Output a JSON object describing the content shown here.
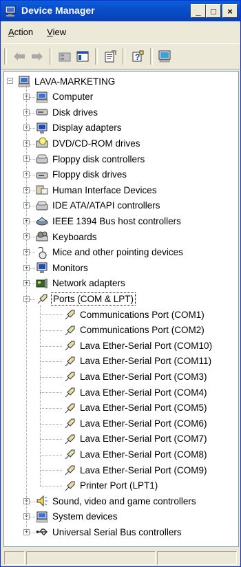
{
  "window": {
    "title": "Device Manager"
  },
  "menu": [
    {
      "label": "Action",
      "accel": "A",
      "rest": "ction"
    },
    {
      "label": "View",
      "accel": "V",
      "rest": "iew"
    }
  ],
  "caption_buttons": {
    "minimize": "_",
    "maximize": "□",
    "close": "×"
  },
  "tree": {
    "root": {
      "label": "LAVA-MARKETING",
      "icon": "computer-icon"
    },
    "categories": [
      {
        "label": "Computer",
        "icon": "computer-icon"
      },
      {
        "label": "Disk drives",
        "icon": "disk-drive-icon"
      },
      {
        "label": "Display adapters",
        "icon": "monitor-icon"
      },
      {
        "label": "DVD/CD-ROM drives",
        "icon": "cdrom-icon"
      },
      {
        "label": "Floppy disk controllers",
        "icon": "controller-icon"
      },
      {
        "label": "Floppy disk drives",
        "icon": "floppy-icon"
      },
      {
        "label": "Human Interface Devices",
        "icon": "hid-icon"
      },
      {
        "label": "IDE ATA/ATAPI controllers",
        "icon": "controller-icon"
      },
      {
        "label": "IEEE 1394 Bus host controllers",
        "icon": "firewire-icon"
      },
      {
        "label": "Keyboards",
        "icon": "keyboard-icon"
      },
      {
        "label": "Mice and other pointing devices",
        "icon": "mouse-icon"
      },
      {
        "label": "Monitors",
        "icon": "monitor-icon"
      },
      {
        "label": "Network adapters",
        "icon": "network-icon"
      },
      {
        "label": "Ports (COM & LPT)",
        "icon": "port-icon"
      }
    ],
    "ports": [
      "Communications Port (COM1)",
      "Communications Port (COM2)",
      "Lava Ether-Serial Port (COM10)",
      "Lava Ether-Serial Port (COM11)",
      "Lava Ether-Serial Port (COM3)",
      "Lava Ether-Serial Port (COM4)",
      "Lava Ether-Serial Port (COM5)",
      "Lava Ether-Serial Port (COM6)",
      "Lava Ether-Serial Port (COM7)",
      "Lava Ether-Serial Port (COM8)",
      "Lava Ether-Serial Port (COM9)",
      "Printer Port (LPT1)"
    ],
    "after": [
      {
        "label": "Sound, video and game controllers",
        "icon": "speaker-icon"
      },
      {
        "label": "System devices",
        "icon": "computer-icon"
      },
      {
        "label": "Universal Serial Bus controllers",
        "icon": "usb-icon"
      }
    ]
  },
  "colors": {
    "titlebar": "#0a4ecb",
    "selection_border": "#000000"
  }
}
